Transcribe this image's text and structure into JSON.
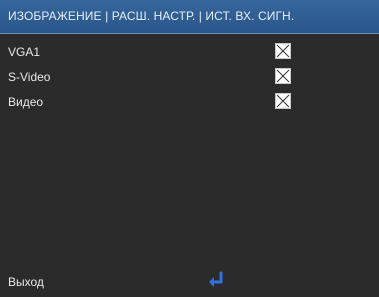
{
  "header": {
    "title": "ИЗОБРАЖЕНИЕ | РАСШ. НАСТР. | ИСТ. ВХ. СИГН."
  },
  "sources": [
    {
      "label": "VGA1",
      "checked": true
    },
    {
      "label": "S-Video",
      "checked": true
    },
    {
      "label": "Видео",
      "checked": true
    }
  ],
  "footer": {
    "exit_label": "Выход",
    "enter_icon": "enter-return-icon"
  },
  "colors": {
    "header_bg": "#2f5f94",
    "panel_bg": "#2b2b2b",
    "enter_icon": "#2f6fe0"
  }
}
